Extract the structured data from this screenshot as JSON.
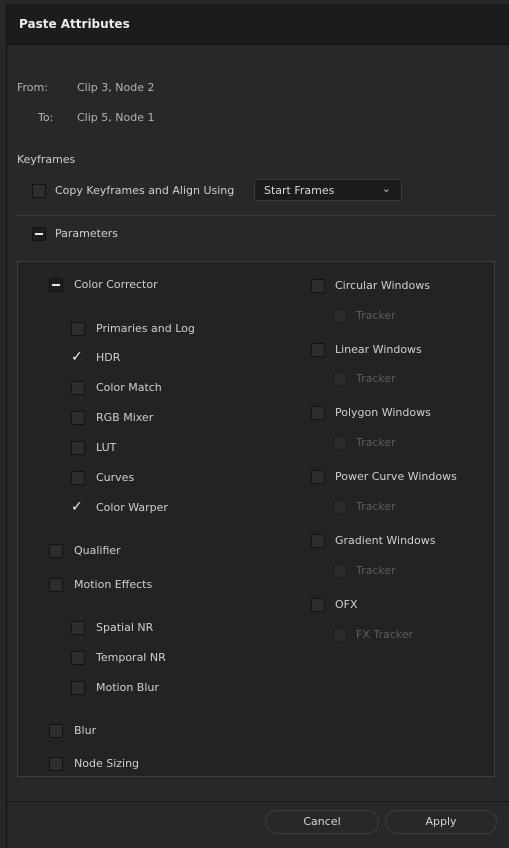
{
  "dialog": {
    "title": "Paste Attributes"
  },
  "source": {
    "from_label": "From:",
    "from_value": "Clip 3, Node 2",
    "to_label": "To:",
    "to_value": "Clip 5, Node 1"
  },
  "keyframes": {
    "heading": "Keyframes",
    "copy_label": "Copy Keyframes and Align Using",
    "copy_checked": false,
    "align_value": "Start Frames"
  },
  "parameters": {
    "label": "Parameters",
    "state": "mixed"
  },
  "left_column": {
    "color_corrector": {
      "label": "Color Corrector",
      "state": "mixed"
    },
    "cc_items": [
      {
        "label": "Primaries and Log",
        "checked": false
      },
      {
        "label": "HDR",
        "checked": true
      },
      {
        "label": "Color Match",
        "checked": false
      },
      {
        "label": "RGB Mixer",
        "checked": false
      },
      {
        "label": "LUT",
        "checked": false
      },
      {
        "label": "Curves",
        "checked": false
      },
      {
        "label": "Color Warper",
        "checked": true
      }
    ],
    "qualifier": {
      "label": "Qualifier",
      "checked": false
    },
    "motion_effects": {
      "label": "Motion Effects",
      "checked": false
    },
    "me_items": [
      {
        "label": "Spatial NR",
        "checked": false
      },
      {
        "label": "Temporal NR",
        "checked": false
      },
      {
        "label": "Motion Blur",
        "checked": false
      }
    ],
    "blur": {
      "label": "Blur",
      "checked": false
    },
    "node_sizing": {
      "label": "Node Sizing",
      "checked": false
    }
  },
  "right_column": {
    "windows": [
      {
        "label": "Circular Windows",
        "sub": "Tracker"
      },
      {
        "label": "Linear Windows",
        "sub": "Tracker"
      },
      {
        "label": "Polygon Windows",
        "sub": "Tracker"
      },
      {
        "label": "Power Curve Windows",
        "sub": "Tracker"
      },
      {
        "label": "Gradient Windows",
        "sub": "Tracker"
      },
      {
        "label": "OFX",
        "sub": "FX Tracker"
      }
    ]
  },
  "buttons": {
    "cancel": "Cancel",
    "apply": "Apply"
  },
  "icons": {
    "dropdown": "chevron-down-icon",
    "check": "checkmark-icon",
    "mixed": "minus-icon"
  }
}
